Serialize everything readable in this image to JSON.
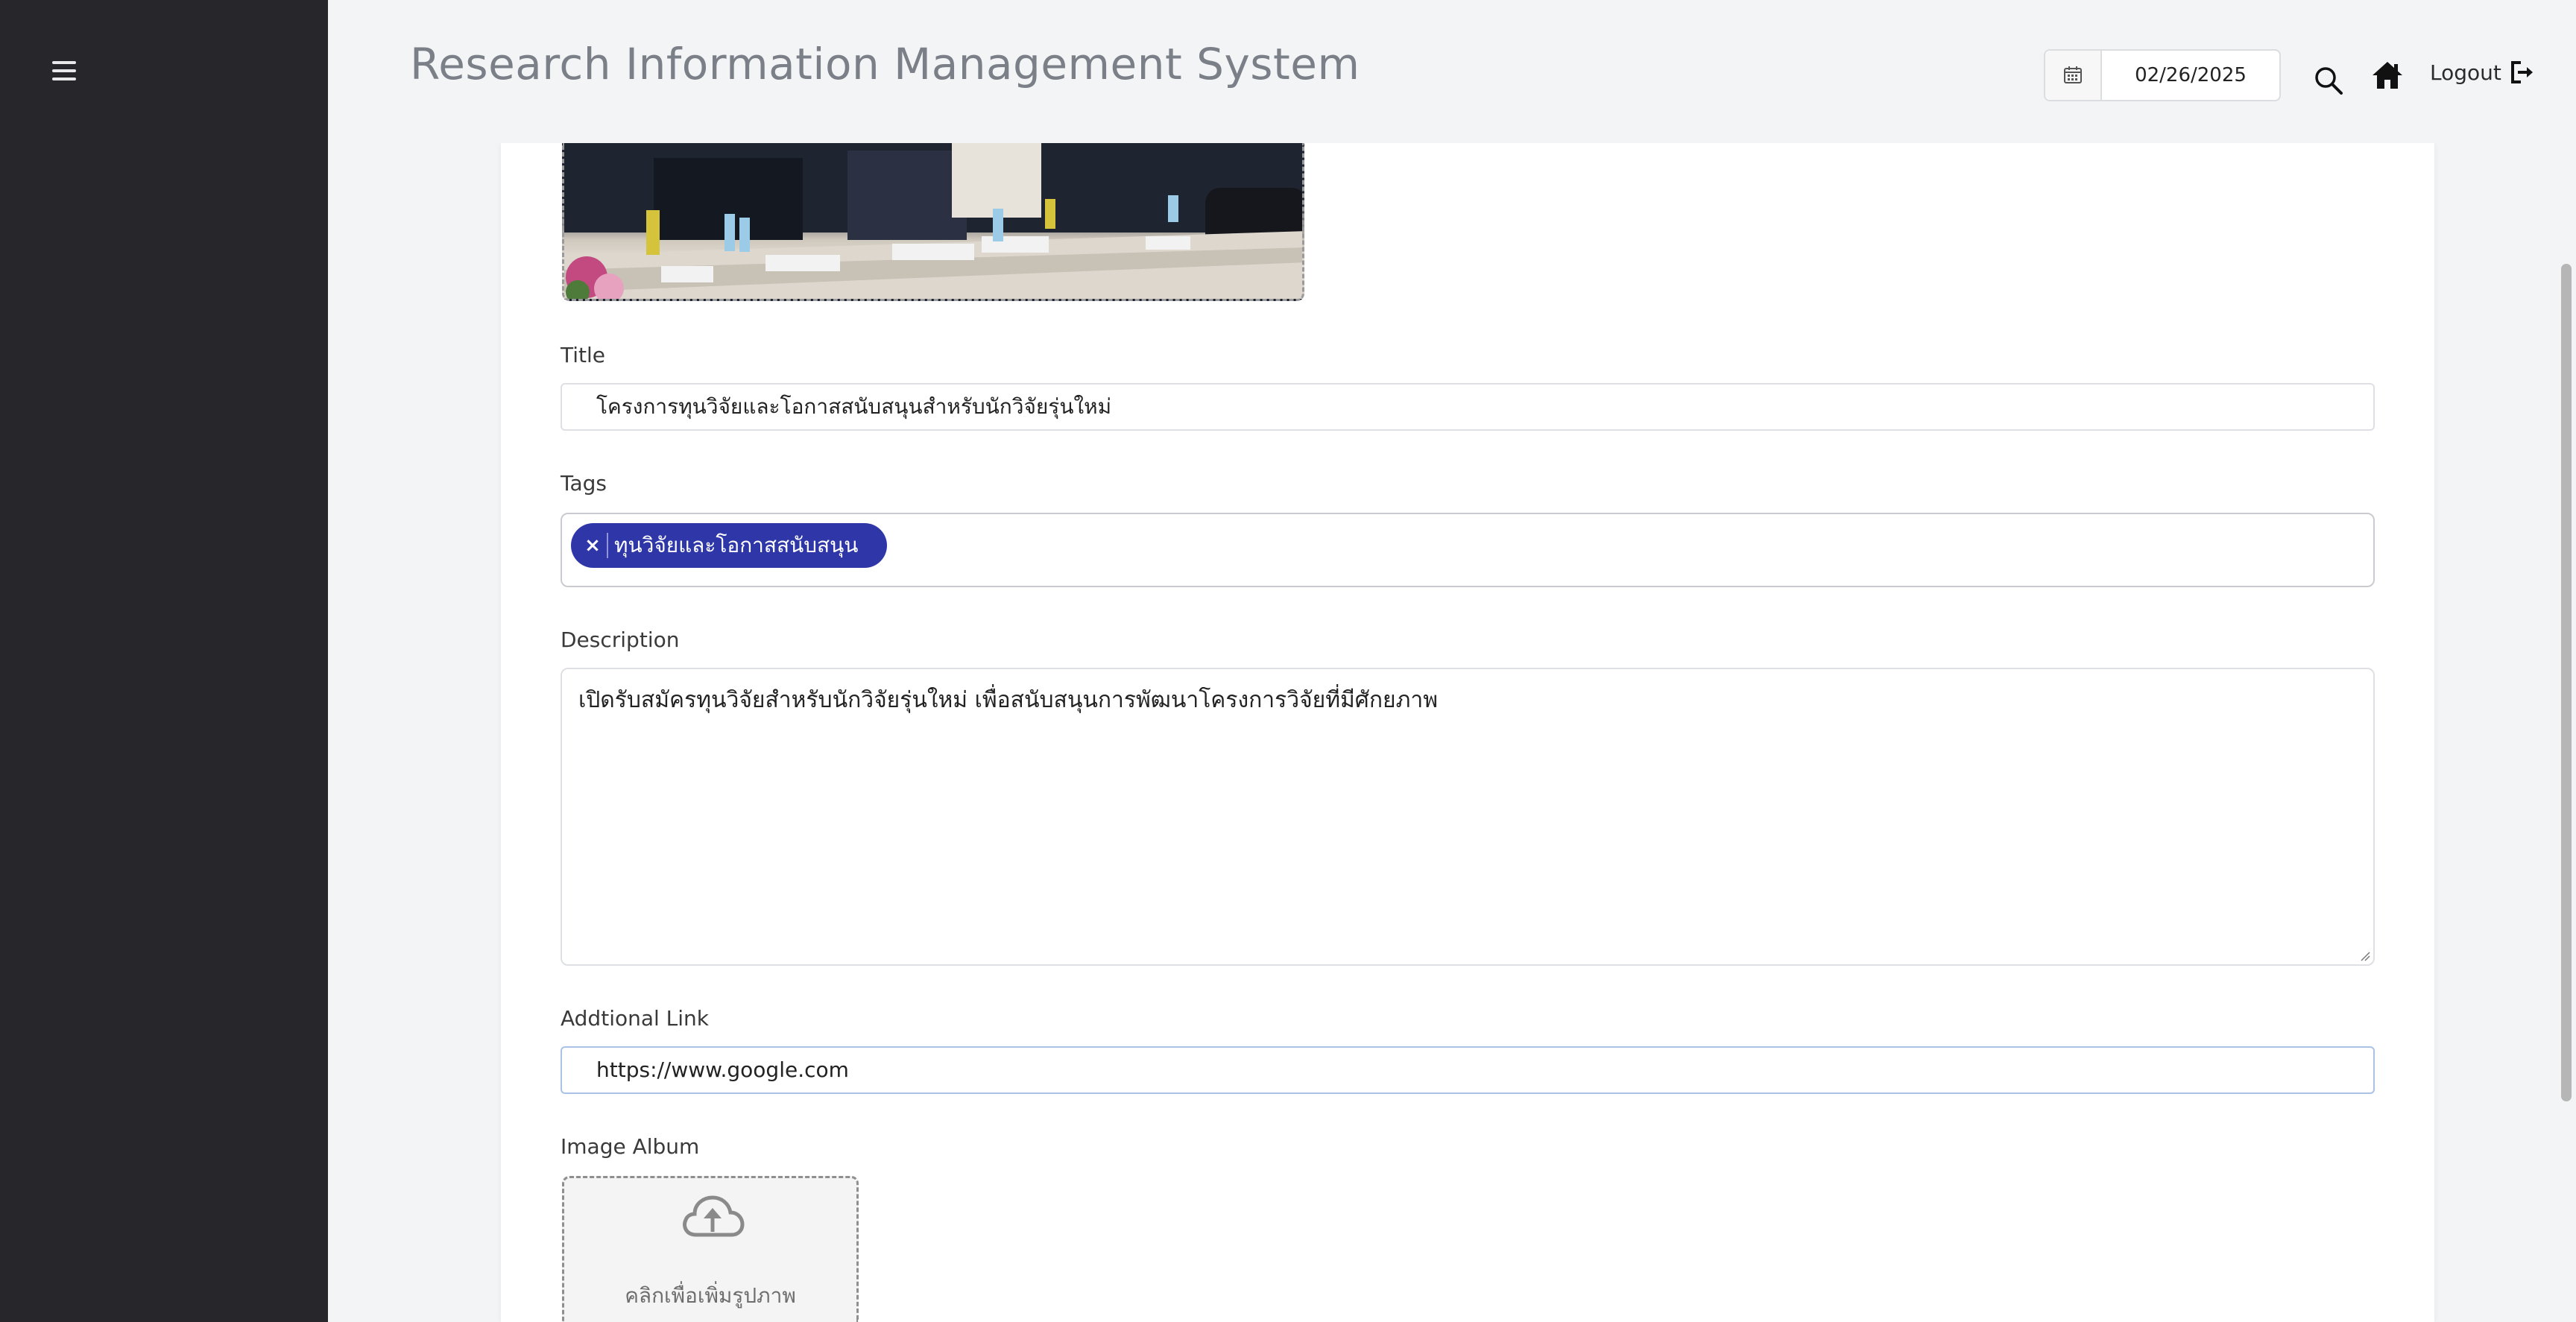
{
  "header": {
    "title": "Research Information Management System",
    "date_value": "02/26/2025",
    "logout_label": "Logout"
  },
  "icons": {
    "menu": "hamburger-icon",
    "calendar": "calendar-icon",
    "search": "search-icon",
    "home": "home-icon",
    "logout": "logout-icon",
    "upload": "cloud-upload-icon"
  },
  "form": {
    "title_label": "Title",
    "title_value": "โครงการทุนวิจัยและโอกาสสนับสนุนสำหรับนักวิจัยรุ่นใหม่",
    "tags_label": "Tags",
    "tags": [
      {
        "label": "ทุนวิจัยและโอกาสสนับสนุน",
        "remove": "×"
      }
    ],
    "description_label": "Description",
    "description_value": "เปิดรับสมัครทุนวิจัยสำหรับนักวิจัยรุ่นใหม่ เพื่อสนับสนุนการพัฒนาโครงการวิจัยที่มีศักยภาพ",
    "link_label": "Addtional Link",
    "link_value": "https://www.google.com",
    "album_label": "Image Album",
    "upload_text": "คลิกเพื่อเพิ่มรูปภาพ"
  },
  "colors": {
    "sidebar": "#26262b",
    "tag_chip": "#2f37a8",
    "page_bg": "#f3f4f6"
  }
}
